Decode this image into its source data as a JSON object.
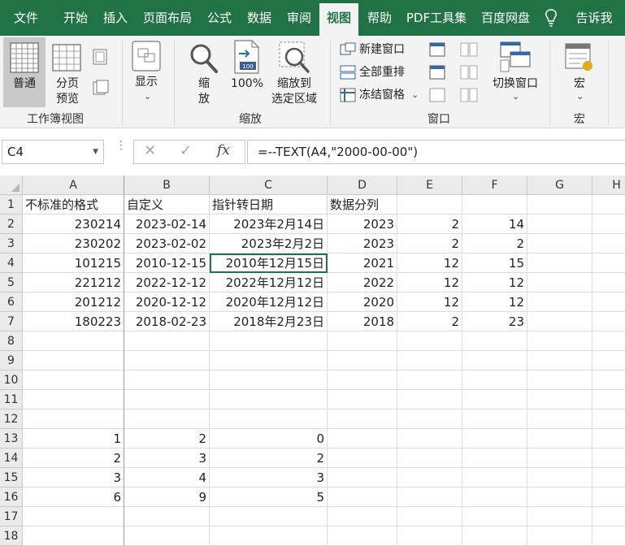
{
  "menu": {
    "tabs": [
      "文件",
      "开始",
      "插入",
      "页面布局",
      "公式",
      "数据",
      "审阅",
      "视图",
      "帮助",
      "PDF工具集",
      "百度网盘",
      "告诉我"
    ],
    "active_tab": "视图"
  },
  "ribbon": {
    "workbook_views": {
      "normal_label": "普通",
      "page_break_label1": "分页",
      "page_break_label2": "预览",
      "group_label": "工作簿视图"
    },
    "show": {
      "label": "显示"
    },
    "zoom": {
      "zoom_label1": "缩",
      "zoom_label2": "放",
      "hundred_label": "100%",
      "zoom_sel_label1": "缩放到",
      "zoom_sel_label2": "选定区域",
      "group_label": "缩放"
    },
    "window": {
      "new_window": "新建窗口",
      "arrange_all": "全部重排",
      "freeze_panes": "冻结窗格",
      "switch_windows": "切换窗口",
      "group_label": "窗口"
    },
    "macros": {
      "label": "宏",
      "group_label": "宏"
    }
  },
  "formula_bar": {
    "name_box": "C4",
    "formula": "=--TEXT(A4,\"2000-00-00\")"
  },
  "sheet": {
    "columns": [
      "A",
      "B",
      "C",
      "D",
      "E",
      "F",
      "G",
      "H"
    ],
    "rows": [
      "1",
      "2",
      "3",
      "4",
      "5",
      "6",
      "7",
      "8",
      "9",
      "10",
      "11",
      "12",
      "13",
      "14",
      "15",
      "16",
      "17",
      "18"
    ],
    "cells": [
      [
        "不标准的格式",
        "自定义",
        "指针转日期",
        "数据分列",
        "",
        "",
        "",
        ""
      ],
      [
        "230214",
        "2023-02-14",
        "2023年2月14日",
        "2023",
        "2",
        "14",
        "",
        ""
      ],
      [
        "230202",
        "2023-02-02",
        "2023年2月2日",
        "2023",
        "2",
        "2",
        "",
        ""
      ],
      [
        "101215",
        "2010-12-15",
        "2010年12月15日",
        "2021",
        "12",
        "15",
        "",
        ""
      ],
      [
        "221212",
        "2022-12-12",
        "2022年12月12日",
        "2022",
        "12",
        "12",
        "",
        ""
      ],
      [
        "201212",
        "2020-12-12",
        "2020年12月12日",
        "2020",
        "12",
        "12",
        "",
        ""
      ],
      [
        "180223",
        "2018-02-23",
        "2018年2月23日",
        "2018",
        "2",
        "23",
        "",
        ""
      ],
      [
        "",
        "",
        "",
        "",
        "",
        "",
        "",
        ""
      ],
      [
        "",
        "",
        "",
        "",
        "",
        "",
        "",
        ""
      ],
      [
        "",
        "",
        "",
        "",
        "",
        "",
        "",
        ""
      ],
      [
        "",
        "",
        "",
        "",
        "",
        "",
        "",
        ""
      ],
      [
        "",
        "",
        "",
        "",
        "",
        "",
        "",
        ""
      ],
      [
        "1",
        "2",
        "0",
        "",
        "",
        "",
        "",
        ""
      ],
      [
        "2",
        "3",
        "2",
        "",
        "",
        "",
        "",
        ""
      ],
      [
        "3",
        "4",
        "3",
        "",
        "",
        "",
        "",
        ""
      ],
      [
        "6",
        "9",
        "5",
        "",
        "",
        "",
        "",
        ""
      ],
      [
        "",
        "",
        "",
        "",
        "",
        "",
        "",
        ""
      ],
      [
        "",
        "",
        "",
        "",
        "",
        "",
        "",
        ""
      ]
    ],
    "selected_cell": "C4"
  },
  "colors": {
    "accent": "#217346",
    "ribbon_bg": "#f3f3f3"
  }
}
